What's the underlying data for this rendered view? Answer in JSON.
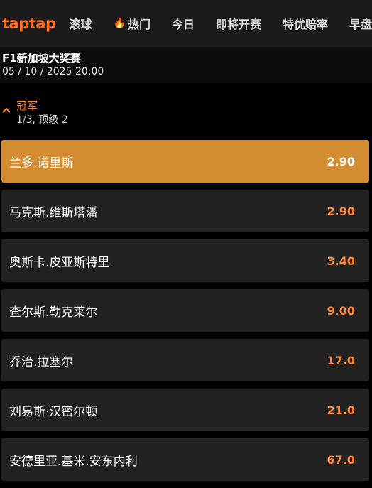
{
  "nav": {
    "logo": "taptap",
    "items": [
      "滚球",
      "热门",
      "今日",
      "即将开赛",
      "特优赔率",
      "早盘"
    ],
    "hot_icon": "flame-icon"
  },
  "event": {
    "title": "F1新加坡大奖赛",
    "datetime": "05 / 10 / 2025 20:00"
  },
  "market": {
    "name": "冠军",
    "subtitle": "1/3, 顶级 2",
    "collapse_icon": "chevron-up-icon"
  },
  "selections": [
    {
      "name": "兰多.诺里斯",
      "odds": "2.90",
      "selected": true
    },
    {
      "name": "马克斯.维斯塔潘",
      "odds": "2.90",
      "selected": false
    },
    {
      "name": "奥斯卡.皮亚斯特里",
      "odds": "3.40",
      "selected": false
    },
    {
      "name": "查尔斯.勒克莱尔",
      "odds": "9.00",
      "selected": false
    },
    {
      "name": "乔治.拉塞尔",
      "odds": "17.0",
      "selected": false
    },
    {
      "name": "刘易斯·汉密尔顿",
      "odds": "21.0",
      "selected": false
    },
    {
      "name": "安德里亚.基米.安东内利",
      "odds": "67.0",
      "selected": false
    }
  ],
  "colors": {
    "accent": "#ff6a1a",
    "selected_bg": "#d38c2f",
    "odds": "#ff8a3d",
    "row_bg": "#222222"
  }
}
